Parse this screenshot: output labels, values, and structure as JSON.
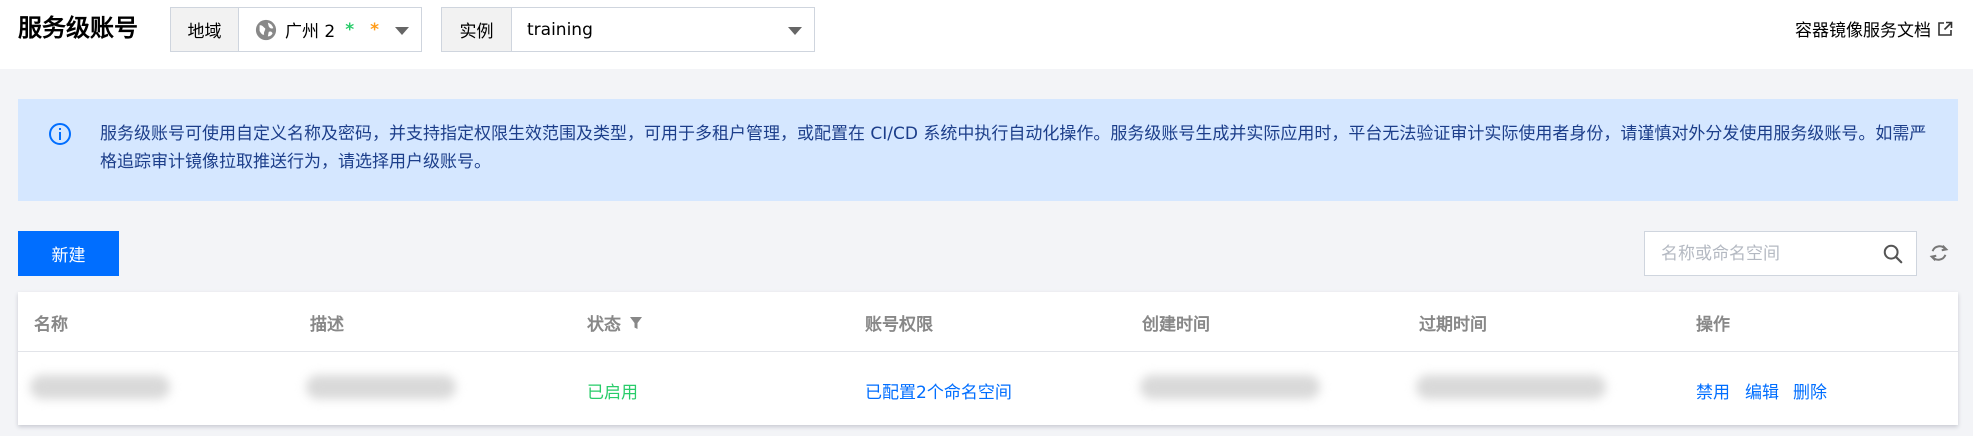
{
  "header": {
    "title": "服务级账号",
    "region": {
      "label": "地域",
      "value": "广州 2",
      "marks": [
        "*",
        "*"
      ]
    },
    "instance": {
      "label": "实例",
      "value": "training"
    },
    "doc_link": "容器镜像服务文档"
  },
  "alert": {
    "text": "服务级账号可使用自定义名称及密码，并支持指定权限生效范围及类型，可用于多租户管理，或配置在 CI/CD 系统中执行自动化操作。服务级账号生成并实际应用时，平台无法验证审计实际使用者身份，请谨慎对外分发使用服务级账号。如需严格追踪审计镜像拉取推送行为，请选择用户级账号。"
  },
  "toolbar": {
    "new_label": "新建",
    "search_placeholder": "名称或命名空间"
  },
  "table": {
    "columns": [
      "名称",
      "描述",
      "状态",
      "账号权限",
      "创建时间",
      "过期时间",
      "操作"
    ],
    "row": {
      "status": "已启用",
      "permission": "已配置2个命名空间",
      "actions": [
        "禁用",
        "编辑",
        "删除"
      ]
    }
  },
  "colors": {
    "primary": "#006eff",
    "success": "#29cc6a",
    "alert_bg": "#d5e7ff",
    "alert_text": "#1c3e8a"
  }
}
